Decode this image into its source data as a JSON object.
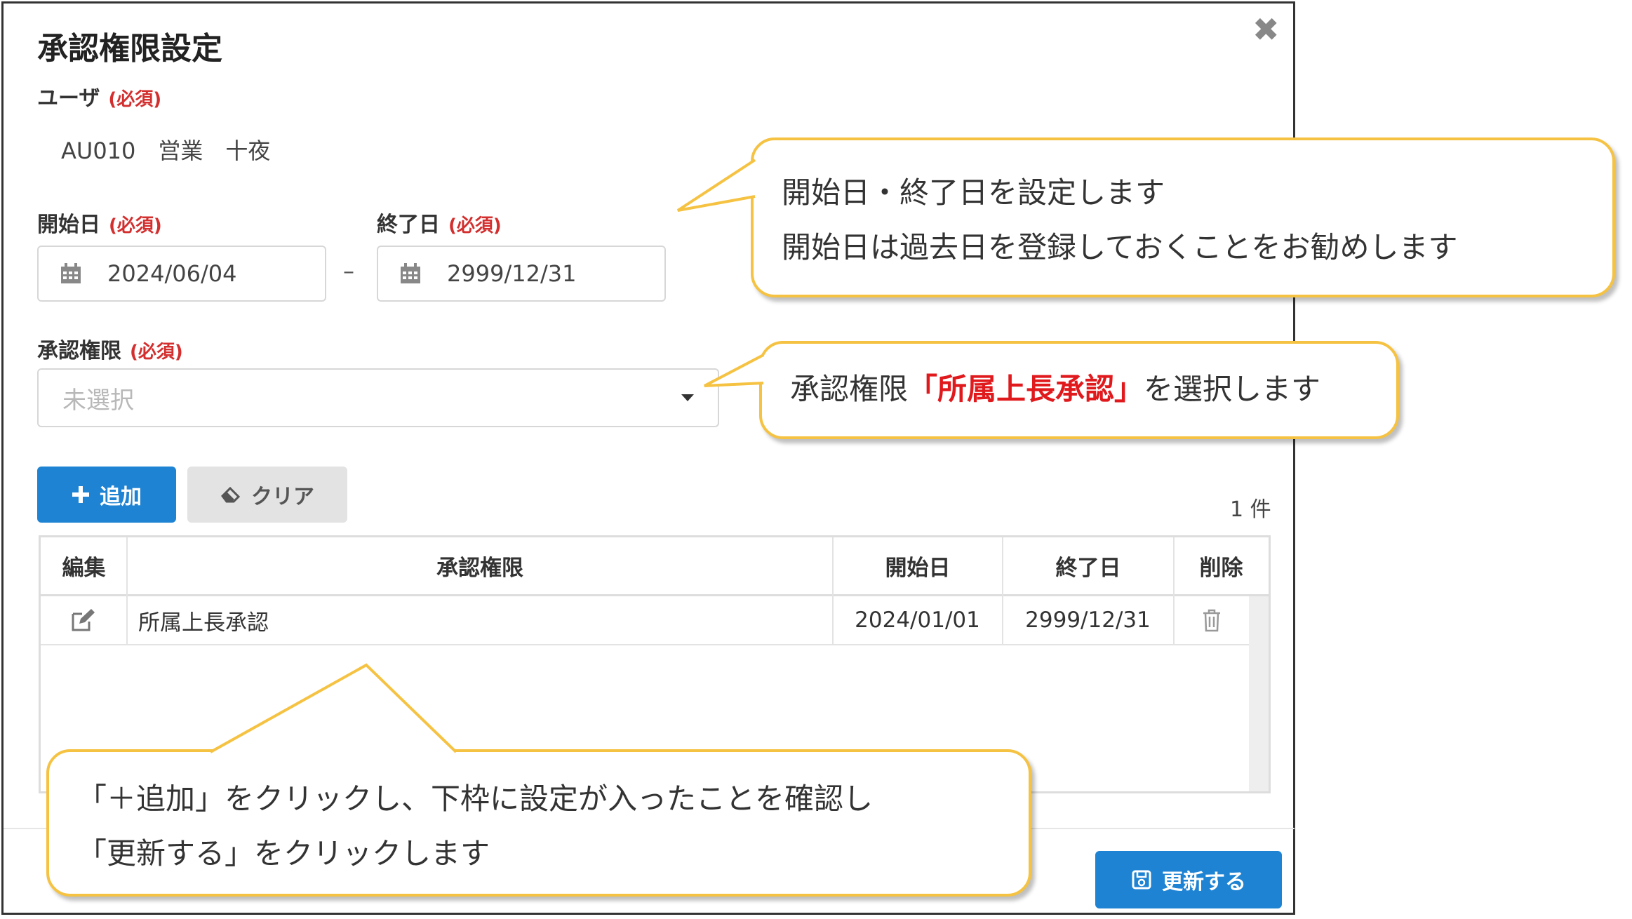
{
  "dialog": {
    "title": "承認権限設定",
    "close_glyph": "✖"
  },
  "required_label": "(必須)",
  "user": {
    "label": "ユーザ",
    "value": "AU010　営業　十夜"
  },
  "start_date": {
    "label": "開始日",
    "value": "2024/06/04"
  },
  "end_date": {
    "label": "終了日",
    "value": "2999/12/31"
  },
  "range_separator": "–",
  "authority": {
    "label": "承認権限",
    "placeholder": "未選択"
  },
  "buttons": {
    "add": "追加",
    "clear": "クリア",
    "update": "更新する"
  },
  "count": "1 件",
  "table": {
    "headers": [
      "編集",
      "承認権限",
      "開始日",
      "終了日",
      "削除"
    ],
    "rows": [
      {
        "authority": "所属上長承認",
        "start": "2024/01/01",
        "end": "2999/12/31"
      }
    ]
  },
  "callouts": {
    "dates": {
      "line1": "開始日・終了日を設定します",
      "line2": "開始日は過去日を登録しておくことをお勧めします"
    },
    "authority": {
      "prefix": "承認権限",
      "highlight": "「所属上長承認」",
      "suffix": "を選択します"
    },
    "add": {
      "line1": "「＋追加」をクリックし、下枠に設定が入ったことを確認し",
      "line2": "「更新する」をクリックします"
    }
  },
  "colors": {
    "primary": "#1e83d2",
    "required": "#d32f2f",
    "callout_border": "#f5c242",
    "highlight": "#e0191d"
  }
}
